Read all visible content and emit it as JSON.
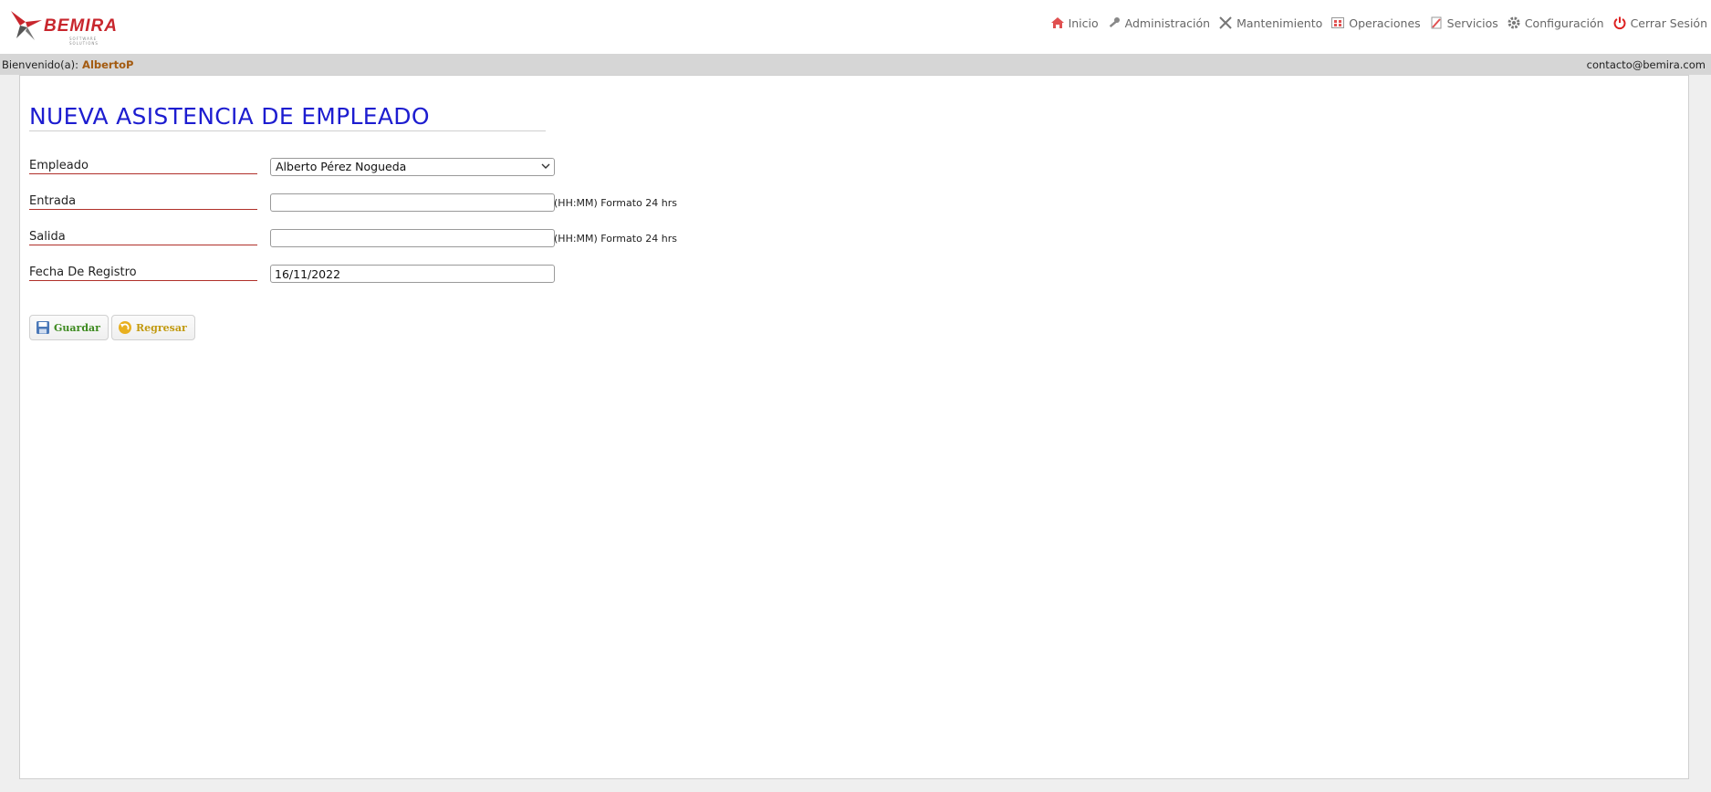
{
  "brand": {
    "name": "BEMIRA",
    "tagline": "SOFTWARE SOLUTIONS",
    "color": "#c8262d"
  },
  "nav": [
    {
      "label": "Inicio",
      "icon": "home-icon"
    },
    {
      "label": "Administración",
      "icon": "key-icon"
    },
    {
      "label": "Mantenimiento",
      "icon": "tools-icon"
    },
    {
      "label": "Operaciones",
      "icon": "calendar-icon"
    },
    {
      "label": "Servicios",
      "icon": "document-icon"
    },
    {
      "label": "Configuración",
      "icon": "gear-icon"
    },
    {
      "label": "Cerrar Sesión",
      "icon": "power-icon"
    }
  ],
  "welcome": {
    "prefix": "Bienvenido(a):",
    "user": "AlbertoP",
    "contact": "contacto@bemira.com"
  },
  "form": {
    "title": "NUEVA ASISTENCIA DE EMPLEADO",
    "employee_label": "Empleado",
    "employee_value": "Alberto Pérez Nogueda",
    "entry_label": "Entrada",
    "entry_value": "",
    "entry_hint": "(HH:MM) Formato 24 hrs",
    "exit_label": "Salida",
    "exit_value": "",
    "exit_hint": "(HH:MM) Formato 24 hrs",
    "date_label": "Fecha De Registro",
    "date_value": "16/11/2022"
  },
  "buttons": {
    "save_label": "Guardar",
    "save_color": "#3d8a1f",
    "back_label": "Regresar",
    "back_color": "#c29a10"
  },
  "colors": {
    "title": "#1d1dd0",
    "label_underline": "#b0302a"
  }
}
